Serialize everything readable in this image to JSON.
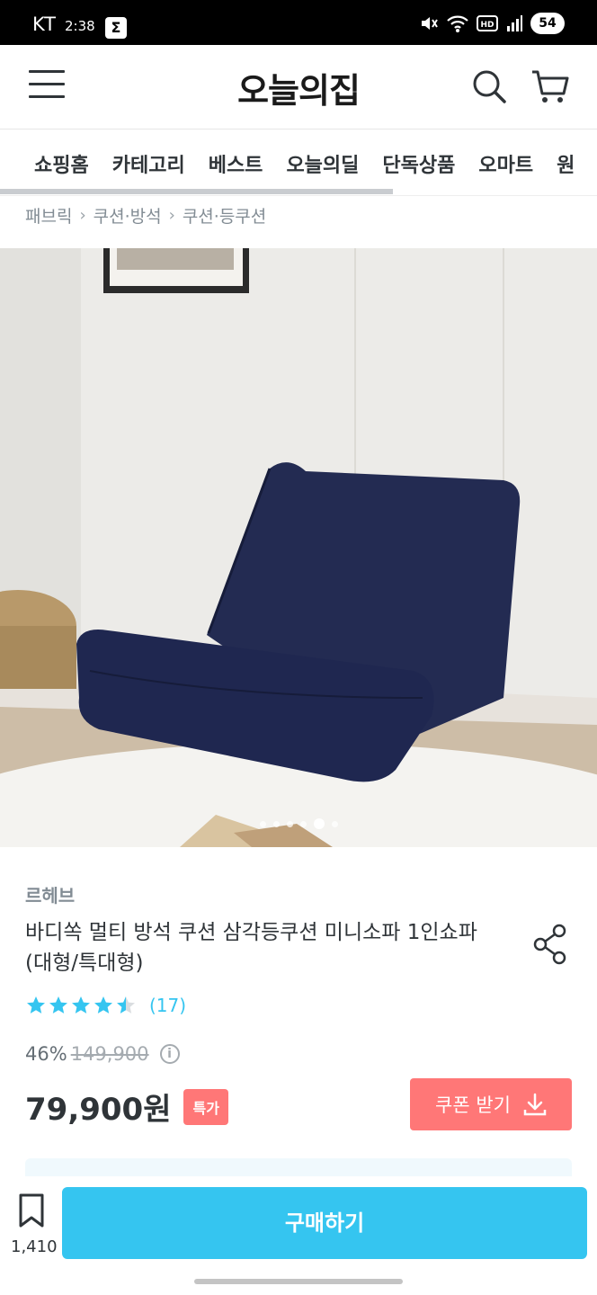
{
  "status_bar": {
    "carrier": "KT",
    "time": "2:38",
    "battery": "54"
  },
  "header": {
    "logo": "오늘의집"
  },
  "nav": {
    "tabs": [
      "쇼핑홈",
      "카테고리",
      "베스트",
      "오늘의딜",
      "단독상품",
      "오마트",
      "원"
    ]
  },
  "breadcrumb": [
    "패브릭",
    "쿠션·방석",
    "쿠션·등쿠션"
  ],
  "gallery": {
    "image_count": 6,
    "active_index": 4
  },
  "product": {
    "brand": "르헤브",
    "title": "바디쏙 멀티 방석 쿠션 삼각등쿠션 미니소파 1인쇼파 (대형/특대형)",
    "rating": 4.5,
    "review_count": "(17)",
    "discount": "46%",
    "original_price": "149,900",
    "info_symbol": "i",
    "price": "79,900원",
    "special_badge": "특가",
    "coupon_label": "쿠폰 받기"
  },
  "bottom_bar": {
    "bookmark_count": "1,410",
    "buy_label": "구매하기"
  },
  "colors": {
    "accent": "#35c5f0",
    "coupon": "#ff7777",
    "text": "#2f3438",
    "muted": "#828c94"
  }
}
